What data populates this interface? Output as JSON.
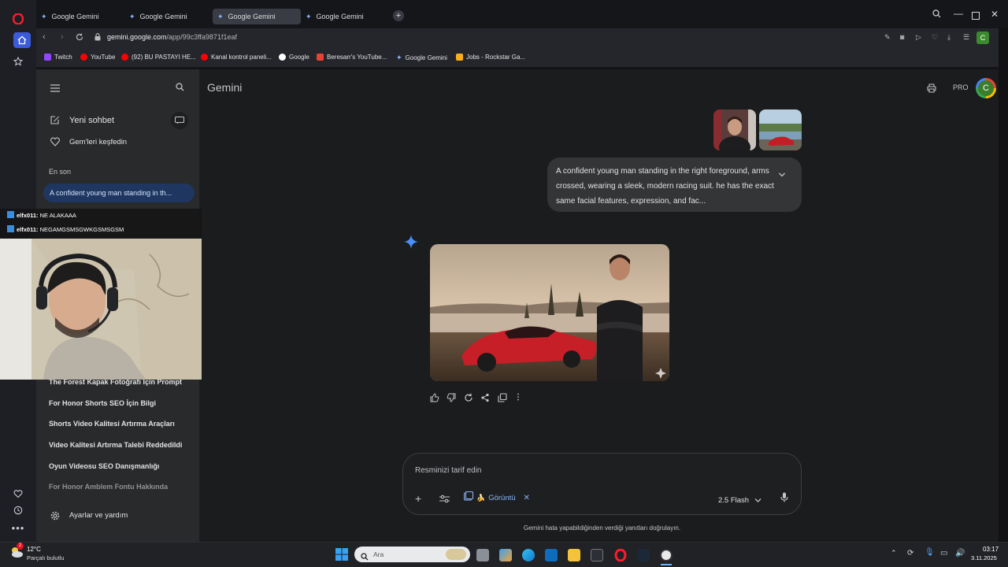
{
  "browser": {
    "tabs": [
      {
        "title": "Google Gemini",
        "active": false
      },
      {
        "title": "Google Gemini",
        "active": false
      },
      {
        "title": "Google Gemini",
        "active": true
      },
      {
        "title": "Google Gemini",
        "active": false
      }
    ],
    "new_tab": "+",
    "url_host": "gemini.google.com",
    "url_path": "/app/99c3ffa9871f1eaf",
    "profile_initial": "C",
    "bookmarks": [
      {
        "label": "Twitch",
        "color": "#9146ff"
      },
      {
        "label": "YouTube",
        "color": "#ff0000"
      },
      {
        "label": "(92) BU PASTAYI HE...",
        "color": "#ff0000"
      },
      {
        "label": "Kanal kontrol paneli...",
        "color": "#ff0000"
      },
      {
        "label": "Google",
        "color": "#ffffff"
      },
      {
        "label": "Beresarr's YouTube...",
        "color": "#e94235"
      },
      {
        "label": "Google Gemini",
        "color": "#8ab4f8"
      },
      {
        "label": "Jobs - Rockstar Ga...",
        "color": "#fcaf17"
      }
    ]
  },
  "sidebar": {
    "new_chat": "Yeni sohbet",
    "explore_gems": "Gem'leri keşfedin",
    "recent_heading": "En son",
    "active_chat": "A confident young man standing in th...",
    "recent_items": [
      "The Forest Kapak Fotoğrafı İçin Prompt",
      "For Honor Shorts SEO İçin Bilgi",
      "Shorts Video Kalitesi Artırma Araçları",
      "Video Kalitesi Artırma Talebi Reddedildi",
      "Oyun Videosu SEO Danışmanlığı",
      "For Honor Amblem Fontu Hakkında"
    ],
    "settings": "Ayarlar ve yardım"
  },
  "header": {
    "brand": "Gemini",
    "plan_badge": "PRO",
    "avatar_initial": "C"
  },
  "conversation": {
    "user_prompt": "A confident young man standing in the right foreground, arms crossed, wearing a sleek, modern racing suit. he has the exact same facial features, expression, and fac..."
  },
  "composer": {
    "placeholder": "Resminizi tarif edin",
    "tool_chip": "Görüntü",
    "tool_chip_emoji": "🍌",
    "model": "2.5 Flash"
  },
  "disclaimer": "Gemini hata yapabildiğinden verdiği yanıtları doğrulayın.",
  "stream_chat": [
    {
      "user": "elfx011:",
      "message": "NE ALAKAAA"
    },
    {
      "user": "elfx011:",
      "message": "NEGAMGSMSGWKGSMSGSM"
    }
  ],
  "taskbar": {
    "weather_temp": "12°C",
    "weather_desc": "Parçalı bulutlu",
    "weather_badge": "2",
    "search_placeholder": "Ara",
    "time": "03:17",
    "date": "3.11.2025"
  },
  "colors": {
    "accent_blue": "#8ab4f8",
    "active_chat_bg": "#1f3760",
    "opera_red": "#ff1b2d"
  }
}
